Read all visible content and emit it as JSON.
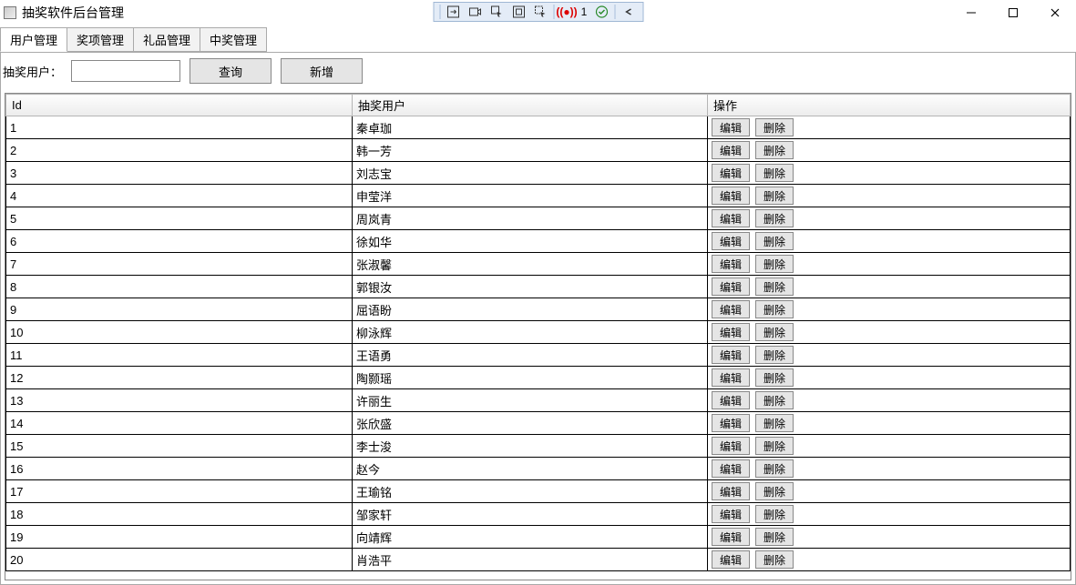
{
  "window": {
    "title": "抽奖软件后台管理"
  },
  "debug_toolbar": {
    "record_count": "1"
  },
  "tabs": [
    {
      "label": "用户管理",
      "active": true
    },
    {
      "label": "奖项管理",
      "active": false
    },
    {
      "label": "礼品管理",
      "active": false
    },
    {
      "label": "中奖管理",
      "active": false
    }
  ],
  "search": {
    "label": "抽奖用户：",
    "value": "",
    "query_btn": "查询",
    "add_btn": "新增"
  },
  "columns": {
    "id": "Id",
    "user": "抽奖用户",
    "ops": "操作"
  },
  "row_buttons": {
    "edit": "编辑",
    "delete": "删除"
  },
  "rows": [
    {
      "id": "1",
      "user": "秦卓珈"
    },
    {
      "id": "2",
      "user": "韩一芳"
    },
    {
      "id": "3",
      "user": "刘志宝"
    },
    {
      "id": "4",
      "user": "申莹洋"
    },
    {
      "id": "5",
      "user": "周岚青"
    },
    {
      "id": "6",
      "user": "徐如华"
    },
    {
      "id": "7",
      "user": "张淑馨"
    },
    {
      "id": "8",
      "user": "郭银汝"
    },
    {
      "id": "9",
      "user": "屈语盼"
    },
    {
      "id": "10",
      "user": "柳泳辉"
    },
    {
      "id": "11",
      "user": "王语勇"
    },
    {
      "id": "12",
      "user": "陶颢瑶"
    },
    {
      "id": "13",
      "user": "许丽生"
    },
    {
      "id": "14",
      "user": "张欣盛"
    },
    {
      "id": "15",
      "user": "李士浚"
    },
    {
      "id": "16",
      "user": "赵今"
    },
    {
      "id": "17",
      "user": "王瑜铭"
    },
    {
      "id": "18",
      "user": "邹家轩"
    },
    {
      "id": "19",
      "user": "向靖辉"
    },
    {
      "id": "20",
      "user": "肖浩平"
    }
  ]
}
